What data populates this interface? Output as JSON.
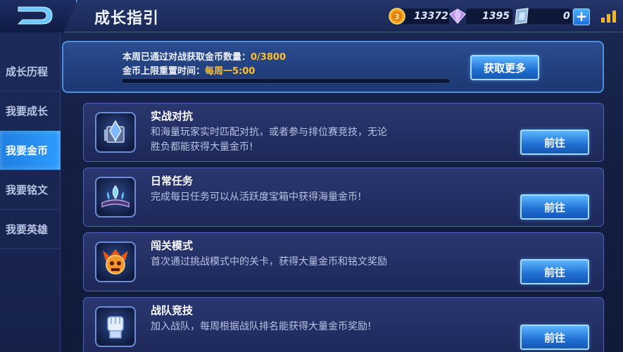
{
  "header": {
    "title": "成长指引",
    "gold": "13372",
    "diamond": "1395",
    "voucher": "0",
    "plus_label": "+"
  },
  "sidebar": {
    "items": [
      {
        "label": "成长历程"
      },
      {
        "label": "我要成长"
      },
      {
        "label": "我要金币"
      },
      {
        "label": "我要铭文"
      },
      {
        "label": "我要英雄"
      }
    ],
    "active_index": 2
  },
  "info": {
    "line1_prefix": "本周已通过对战获取金币数量：",
    "line1_value": "0/3800",
    "line2_prefix": "金币上限重置时间：",
    "line2_value": "每周一5:00",
    "progress_fraction": 0,
    "more_button": "获取更多"
  },
  "cards": [
    {
      "title": "实战对抗",
      "desc": "和海量玩家实时匹配对抗，或者参与排位赛竞技，无论胜负都能获得大量金币!",
      "button": "前往",
      "icon": "pvp-trophy-icon"
    },
    {
      "title": "日常任务",
      "desc": "完成每日任务可以从活跃度宝箱中获得海量金币!",
      "button": "前往",
      "icon": "daily-task-book-icon"
    },
    {
      "title": "闯关模式",
      "desc": "首次通过挑战模式中的关卡，获得大量金币和铭文奖励",
      "button": "前往",
      "icon": "dungeon-skull-icon"
    },
    {
      "title": "战队竞技",
      "desc": "加入战队，每周根据战队排名能获得大量金币奖励!",
      "button": "前往",
      "icon": "team-fist-icon"
    }
  ],
  "colors": {
    "accent_blue": "#2f9bff",
    "highlight_gold": "#ffc02b"
  }
}
